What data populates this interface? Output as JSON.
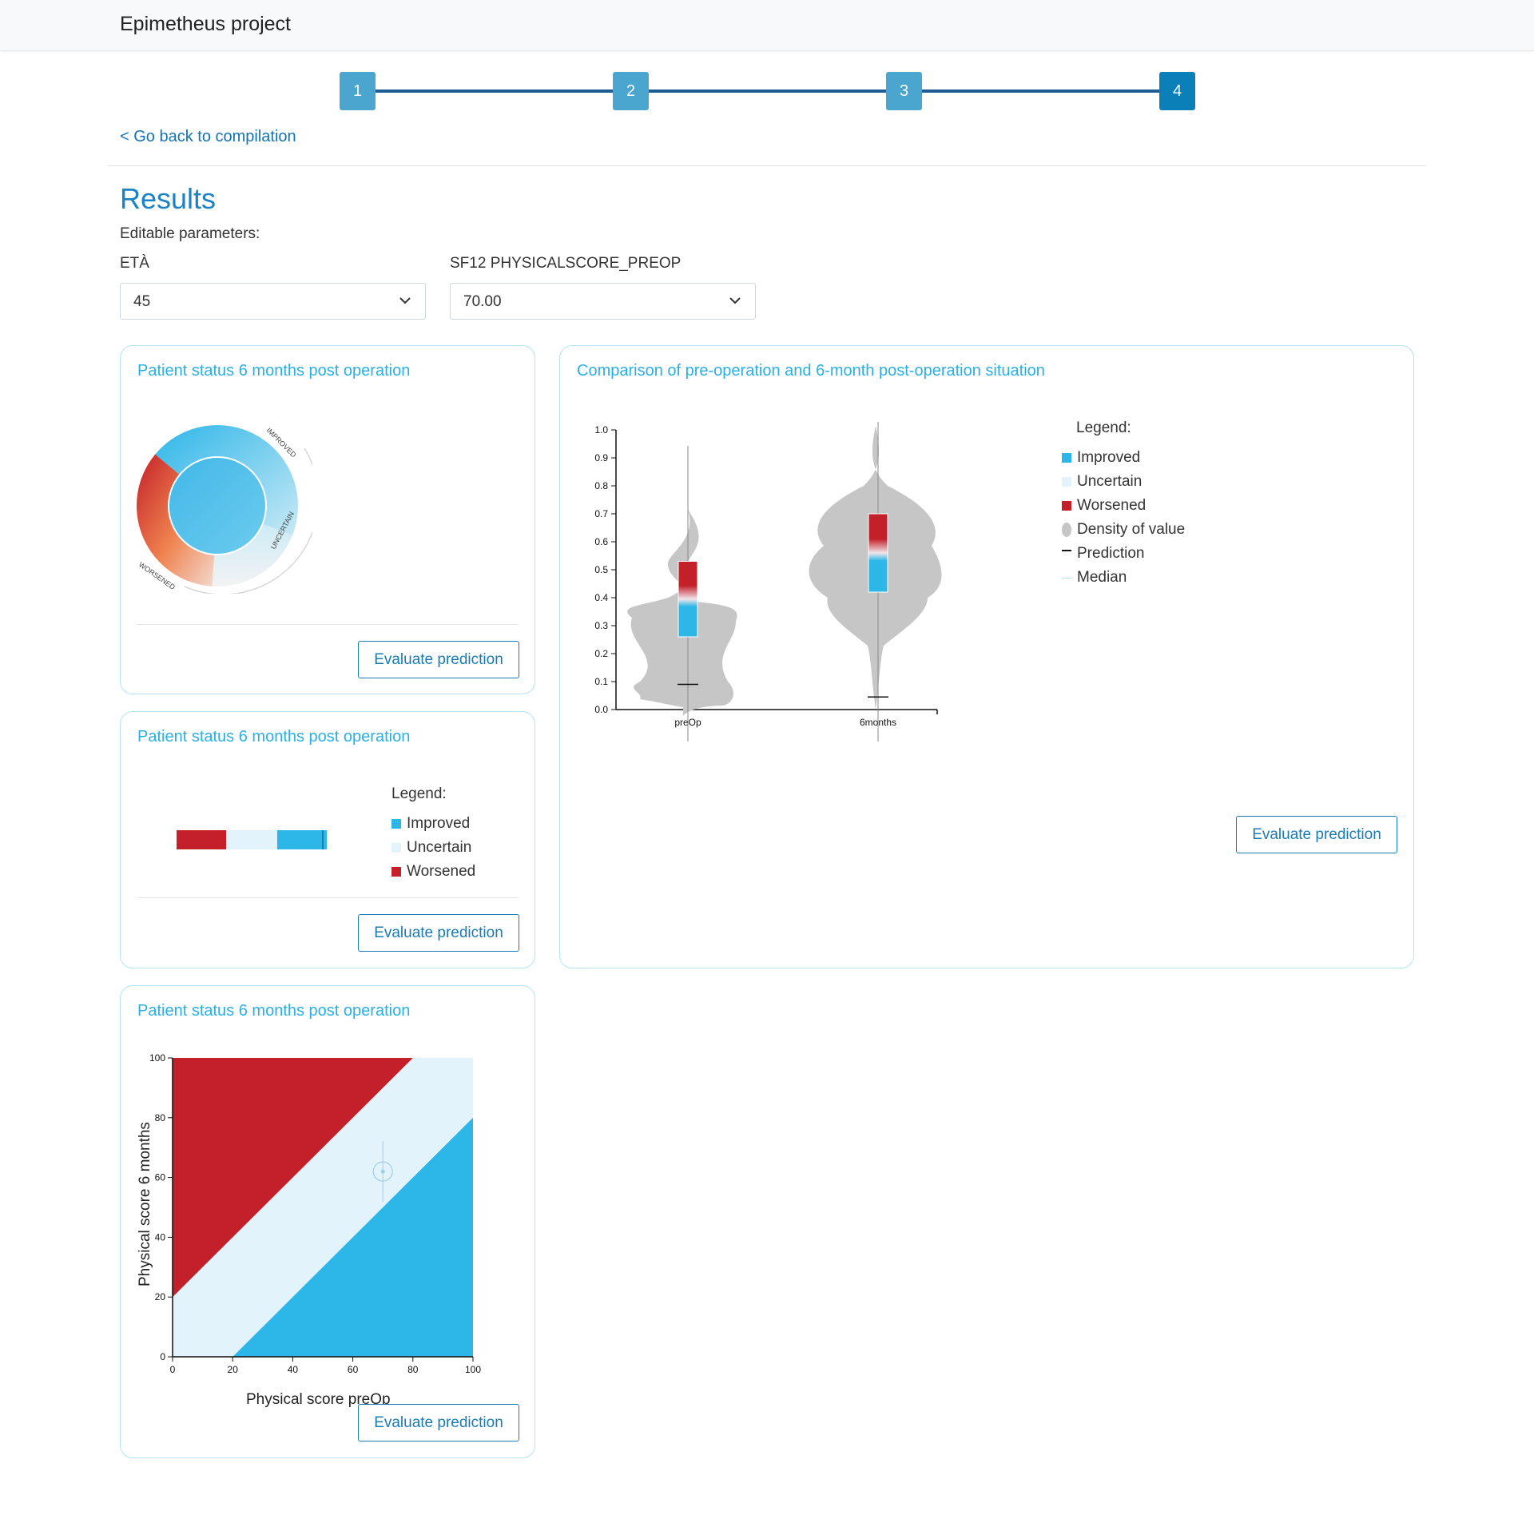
{
  "app": {
    "title": "Epimetheus project"
  },
  "stepper": {
    "steps": [
      "1",
      "2",
      "3",
      "4"
    ],
    "active": 3
  },
  "nav": {
    "back_label": "< Go back to compilation"
  },
  "results": {
    "title": "Results",
    "editable_label": "Editable parameters:",
    "params": [
      {
        "label": "ETÀ",
        "value": "45"
      },
      {
        "label": "SF12 PHYSICALSCORE_PREOP",
        "value": "70.00"
      }
    ]
  },
  "cards": {
    "donut": {
      "title": "Patient status 6 months post operation",
      "button": "Evaluate prediction",
      "labels": [
        "IMPROVED",
        "UNCERTAIN",
        "WORSENED"
      ]
    },
    "bar": {
      "title": "Patient status 6 months post operation",
      "button": "Evaluate prediction",
      "legend_title": "Legend:",
      "legend": [
        "Improved",
        "Uncertain",
        "Worsened"
      ]
    },
    "violin": {
      "title": "Comparison of pre-operation and 6-month post-operation situation",
      "button": "Evaluate prediction",
      "legend_title": "Legend:",
      "legend": [
        "Improved",
        "Uncertain",
        "Worsened",
        "Density of value",
        "Prediction",
        "Median"
      ]
    },
    "scatter": {
      "title": "Patient status 6 months post operation",
      "button": "Evaluate prediction",
      "xlabel": "Physical score preOp",
      "ylabel": "Physical score 6 months"
    }
  },
  "colors": {
    "improved": "#2db6e8",
    "uncertain": "#e3f3fb",
    "worsened": "#c42029",
    "density": "#c6c6c6",
    "accent": "#29b0e6",
    "link": "#1273b5"
  },
  "chart_data": [
    {
      "type": "pie",
      "labels": [
        "IMPROVED",
        "UNCERTAIN",
        "WORSENED"
      ],
      "values": [
        0.45,
        0.2,
        0.35
      ]
    },
    {
      "type": "bar",
      "categories": [
        "Worsened",
        "Uncertain",
        "Improved"
      ],
      "values": [
        0.33,
        0.34,
        0.33
      ]
    },
    {
      "type": "area",
      "categories": [
        "preOp",
        "6months"
      ],
      "ylim": [
        0,
        1
      ],
      "yticks": [
        "0.0",
        "0.1",
        "0.2",
        "0.3",
        "0.4",
        "0.5",
        "0.6",
        "0.7",
        "0.8",
        "0.9",
        "1.0"
      ],
      "box": [
        {
          "category": "preOp",
          "low": 0.26,
          "high": 0.53,
          "prediction": 0.09
        },
        {
          "category": "6months",
          "low": 0.42,
          "high": 0.7,
          "prediction": 0.045
        }
      ]
    },
    {
      "type": "area",
      "xlabel": "Physical score preOp",
      "ylabel": "Physical score 6 months",
      "xlim": [
        0,
        100
      ],
      "ylim": [
        0,
        100
      ],
      "xticks": [
        "0",
        "20",
        "40",
        "60",
        "80",
        "100"
      ],
      "yticks": [
        "0",
        "20",
        "40",
        "60",
        "80",
        "100"
      ],
      "worsened_region": [
        [
          0,
          20
        ],
        [
          0,
          100
        ],
        [
          80,
          100
        ]
      ],
      "improved_region": [
        [
          20,
          0
        ],
        [
          100,
          0
        ],
        [
          100,
          80
        ]
      ],
      "prediction_point": [
        70,
        62
      ]
    }
  ]
}
